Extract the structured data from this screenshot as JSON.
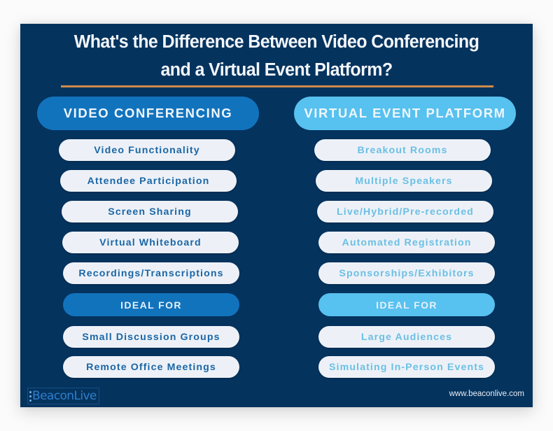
{
  "title": {
    "line1": "What's the Difference Between Video Conferencing",
    "line2": "and a Virtual Event Platform?"
  },
  "colors": {
    "background": "#04335e",
    "divider": "#cd8b4b",
    "video_conferencing_accent": "#1273bd",
    "virtual_event_accent": "#57c1ef",
    "pill_background": "#edf1f7",
    "video_conferencing_text": "#1a66a6",
    "virtual_event_text": "#6bbfe4"
  },
  "columns": [
    {
      "header": "VIDEO CONFERENCING",
      "features": [
        "Video Functionality",
        "Attendee Participation",
        "Screen Sharing",
        "Virtual Whiteboard",
        "Recordings/Transcriptions"
      ],
      "ideal_for_label": "IDEAL FOR",
      "ideal_for": [
        "Small Discussion Groups",
        "Remote Office Meetings"
      ]
    },
    {
      "header": "VIRTUAL EVENT PLATFORM",
      "features": [
        "Breakout Rooms",
        "Multiple Speakers",
        "Live/Hybrid/Pre-recorded",
        "Automated Registration",
        "Sponsorships/Exhibitors"
      ],
      "ideal_for_label": "IDEAL FOR",
      "ideal_for": [
        "Large Audiences",
        "Simulating In-Person Events"
      ]
    }
  ],
  "footer": {
    "logo_text": "BeaconLive",
    "logo_icon": "beacon-dots-icon",
    "website": "www.beaconlive.com"
  }
}
